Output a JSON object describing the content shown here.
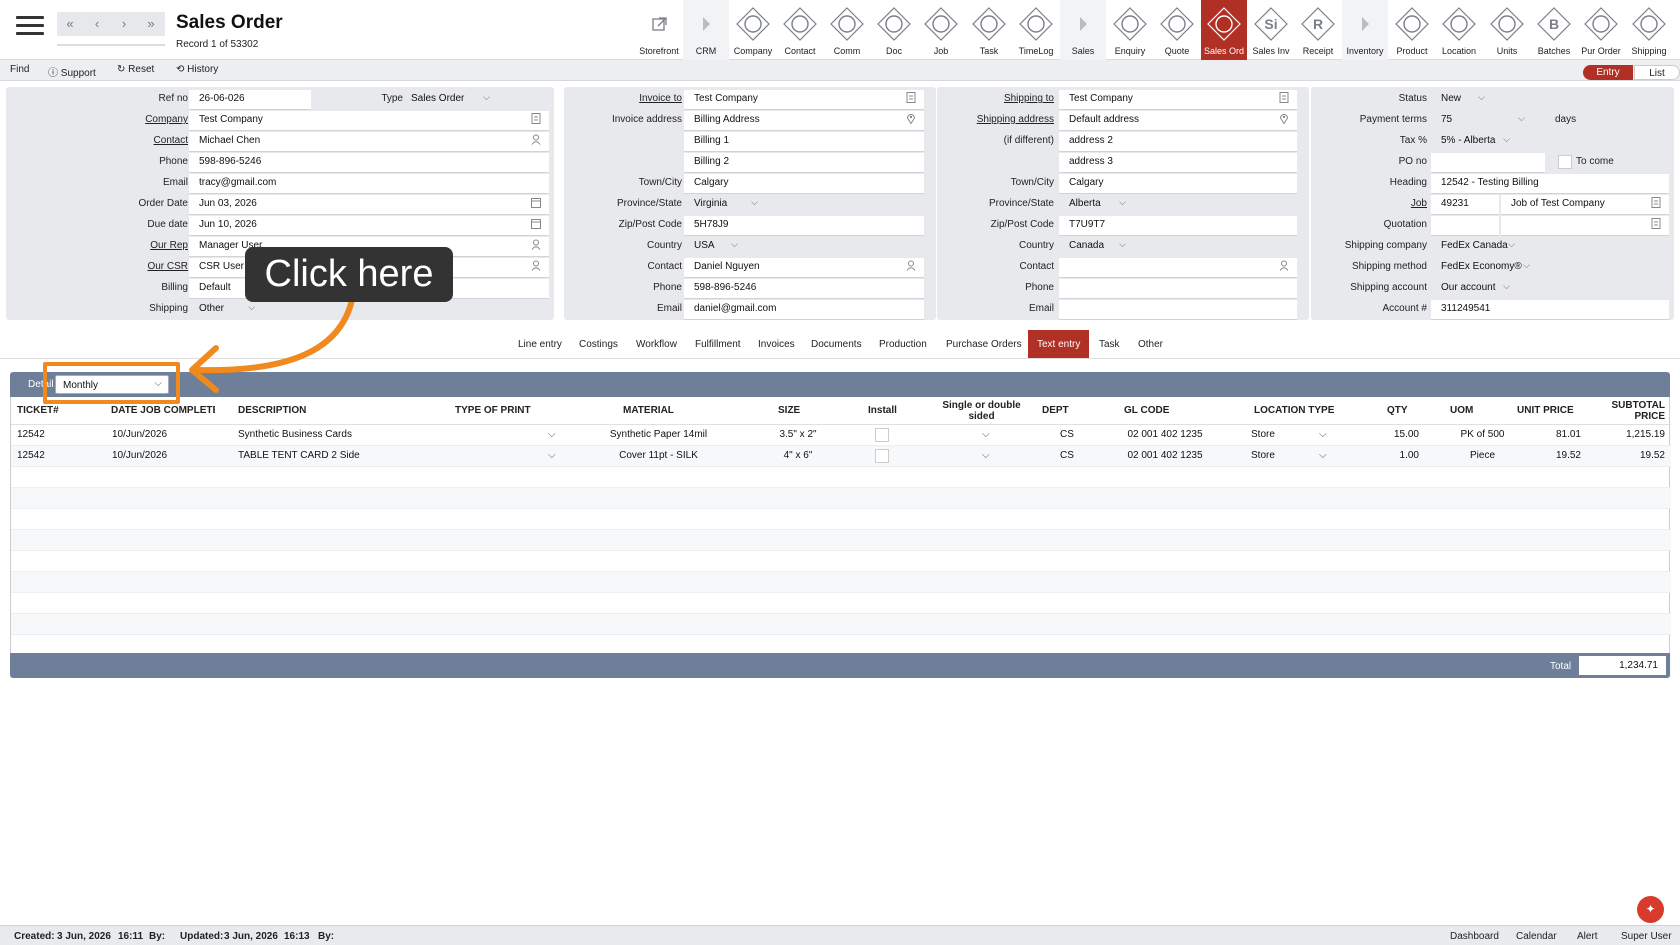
{
  "header": {
    "title": "Sales Order",
    "record_info": "Record 1 of 53302"
  },
  "toolbar": [
    {
      "label": "Storefront",
      "icon": "external-link-icon"
    },
    {
      "label": "CRM",
      "icon": "chevron-right-icon"
    },
    {
      "label": "Company",
      "icon": "company-icon"
    },
    {
      "label": "Contact",
      "icon": "contact-icon"
    },
    {
      "label": "Comm",
      "icon": "comm-icon"
    },
    {
      "label": "Doc",
      "icon": "doc-icon"
    },
    {
      "label": "Job",
      "icon": "job-icon"
    },
    {
      "label": "Task",
      "icon": "task-icon"
    },
    {
      "label": "TimeLog",
      "icon": "clock-icon"
    },
    {
      "label": "Sales",
      "icon": "chevron-right-icon"
    },
    {
      "label": "Enquiry",
      "icon": "enquiry-icon"
    },
    {
      "label": "Quote",
      "icon": "quote-icon"
    },
    {
      "label": "Sales Ord",
      "icon": "sales-order-icon"
    },
    {
      "label": "Sales Inv",
      "icon": "sales-invoice-icon"
    },
    {
      "label": "Receipt",
      "icon": "receipt-icon"
    },
    {
      "label": "Inventory",
      "icon": "chevron-right-icon"
    },
    {
      "label": "Product",
      "icon": "product-icon"
    },
    {
      "label": "Location",
      "icon": "location-icon"
    },
    {
      "label": "Units",
      "icon": "units-icon"
    },
    {
      "label": "Batches",
      "icon": "batches-icon"
    },
    {
      "label": "Pur Order",
      "icon": "cart-icon"
    },
    {
      "label": "Shipping",
      "icon": "truck-icon"
    }
  ],
  "toolbar_icon_letters": {
    "sales_inv": "Si",
    "receipt": "R",
    "batches": "B"
  },
  "menu": {
    "find": "Find",
    "support": "Support",
    "reset": "Reset",
    "history": "History"
  },
  "view_toggle": {
    "entry": "Entry",
    "list": "List"
  },
  "panel1": {
    "ref_no_label": "Ref no",
    "ref_no": "26-06-026",
    "type_label": "Type",
    "type": "Sales Order",
    "company_label": "Company",
    "company": "Test Company",
    "contact_label": "Contact",
    "contact": "Michael Chen",
    "phone_label": "Phone",
    "phone": "598-896-5246",
    "email_label": "Email",
    "email": "tracy@gmail.com",
    "order_date_label": "Order Date",
    "order_date": "Jun 03, 2026",
    "due_date_label": "Due date",
    "due_date": "Jun 10, 2026",
    "our_rep_label": "Our Rep",
    "our_rep": "Manager User",
    "our_csr_label": "Our CSR",
    "our_csr": "CSR User",
    "billing_label": "Billing",
    "billing": "Default",
    "shipping_label": "Shipping",
    "shipping": "Other"
  },
  "panel2": {
    "invoice_to_label": "Invoice to",
    "invoice_to": "Test Company",
    "invoice_address_label": "Invoice address",
    "invoice_address": "Billing Address",
    "billing1": "Billing 1",
    "billing2": "Billing 2",
    "town_label": "Town/City",
    "town": "Calgary",
    "province_label": "Province/State",
    "province": "Virginia",
    "zip_label": "Zip/Post Code",
    "zip": "5H78J9",
    "country_label": "Country",
    "country": "USA",
    "contact_label": "Contact",
    "contact": "Daniel Nguyen",
    "phone_label": "Phone",
    "phone": "598-896-5246",
    "email_label": "Email",
    "email": "daniel@gmail.com"
  },
  "panel3": {
    "shipping_to_label": "Shipping to",
    "shipping_to": "Test Company",
    "shipping_address_label": "Shipping address",
    "shipping_address": "Default address",
    "if_different_label": "(if different)",
    "address2": "address 2",
    "address3": "address 3",
    "town_label": "Town/City",
    "town": "Calgary",
    "province_label": "Province/State",
    "province": "Alberta",
    "zip_label": "Zip/Post Code",
    "zip": "T7U9T7",
    "country_label": "Country",
    "country": "Canada",
    "contact_label": "Contact",
    "contact": "",
    "phone_label": "Phone",
    "phone": "",
    "email_label": "Email",
    "email": ""
  },
  "panel4": {
    "status_label": "Status",
    "status": "New",
    "payment_terms_label": "Payment terms",
    "payment_terms": "75",
    "days": "days",
    "tax_label": "Tax %",
    "tax": "5% - Alberta",
    "po_label": "PO no",
    "to_come": "To come",
    "heading_label": "Heading",
    "heading": "12542 - Testing Billing",
    "job_label": "Job",
    "job": "49231",
    "job_desc": "Job of Test Company",
    "quotation_label": "Quotation",
    "shipping_company_label": "Shipping company",
    "shipping_company": "FedEx Canada",
    "shipping_method_label": "Shipping method",
    "shipping_method": "FedEx Economy®",
    "shipping_account_label": "Shipping account",
    "shipping_account": "Our account",
    "account_label": "Account #",
    "account": "311249541"
  },
  "tabs": [
    "Line entry",
    "Costings",
    "Workflow",
    "Fulfillment",
    "Invoices",
    "Documents",
    "Production",
    "Purchase Orders",
    "Text entry",
    "Task",
    "Other"
  ],
  "active_tab": "Text entry",
  "detail": {
    "label": "Detail",
    "select": "Monthly"
  },
  "columns": [
    "TICKET#",
    "DATE JOB COMPLETE",
    "DESCRIPTION",
    "TYPE OF PRINT",
    "MATERIAL",
    "SIZE",
    "Install",
    "Single or double",
    "sided",
    "DEPT",
    "GL CODE",
    "LOCATION TYPE",
    "QTY",
    "UOM",
    "UNIT PRICE",
    "SUBTOTAL",
    "PRICE"
  ],
  "rows": [
    {
      "ticket": "12542",
      "date": "10/Jun/2026",
      "desc": "Synthetic Business Cards",
      "material": "Synthetic Paper 14mil",
      "size": "3.5\" x 2\"",
      "dept": "CS",
      "gl": "02 001 402 1235",
      "loc": "Store",
      "qty": "15.00",
      "uom": "PK of 500",
      "unit": "81.01",
      "sub": "1,215.19"
    },
    {
      "ticket": "12542",
      "date": "10/Jun/2026",
      "desc": "TABLE TENT CARD 2 Side",
      "material": "Cover 11pt - SILK",
      "size": "4\" x 6\"",
      "dept": "CS",
      "gl": "02 001 402 1235",
      "loc": "Store",
      "qty": "1.00",
      "uom": "Piece",
      "unit": "19.52",
      "sub": "19.52"
    }
  ],
  "total": {
    "label": "Total",
    "value": "1,234.71"
  },
  "status": {
    "created_label": "Created:",
    "created": "3 Jun, 2026",
    "created_time": "16:11",
    "by1": "By:",
    "updated_label": "Updated:",
    "updated": "3 Jun, 2026",
    "updated_time": "16:13",
    "by2": "By:",
    "dashboard": "Dashboard",
    "calendar": "Calendar",
    "alert": "Alert",
    "user": "Super User"
  },
  "callout": "Click here",
  "colors": {
    "accent": "#b03026",
    "header_bar": "#6e7f99",
    "callout_orange": "#f08a1e"
  }
}
